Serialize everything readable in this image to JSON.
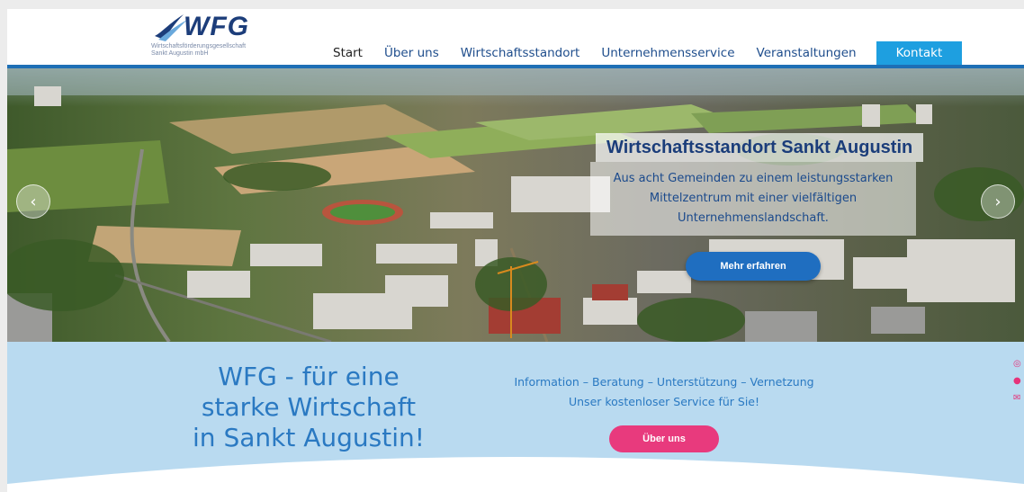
{
  "logo": {
    "name": "WFG",
    "subtitle_line1": "Wirtschaftsförderungsgesellschaft",
    "subtitle_line2": "Sankt Augustin mbH"
  },
  "nav": {
    "items": [
      {
        "label": "Start",
        "active": true
      },
      {
        "label": "Über uns"
      },
      {
        "label": "Wirtschaftsstandort"
      },
      {
        "label": "Unternehmensservice"
      },
      {
        "label": "Veranstaltungen"
      }
    ],
    "contact_label": "Kontakt"
  },
  "hero": {
    "title": "Wirtschaftsstandort Sankt Augustin",
    "text_lines": [
      "Aus acht Gemeinden zu einem leistungsstarken",
      "Mittelzentrum mit einer vielfältigen",
      "Unternehmenslandschaft."
    ],
    "button_label": "Mehr erfahren",
    "prev_icon": "‹",
    "next_icon": "›"
  },
  "band": {
    "headline_lines": [
      "WFG - für eine",
      "starke Wirtschaft",
      "in Sankt Augustin!"
    ],
    "sub_line1": "Information – Beratung – Unterstützung – Vernetzung",
    "sub_line2": "Unser kostenloser Service für Sie!",
    "button_label": "Über uns"
  },
  "social": [
    "instagram-icon",
    "facebook-icon",
    "mail-icon"
  ],
  "colors": {
    "brand_blue": "#1e6fb5",
    "contact_blue": "#1e9fe0",
    "accent_pink": "#e6337a",
    "band_bg": "#b9daf0"
  }
}
